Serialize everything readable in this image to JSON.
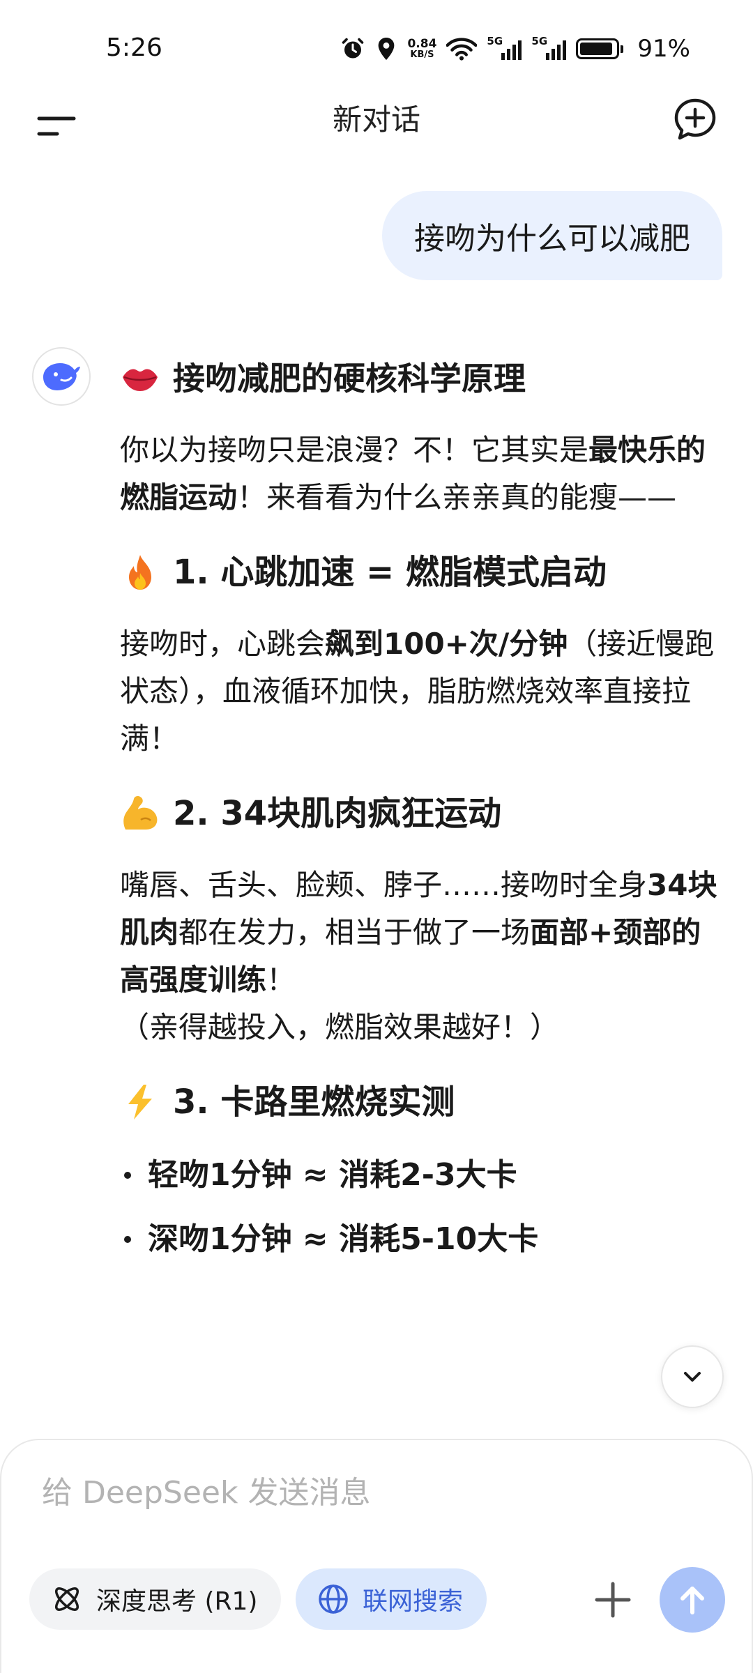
{
  "status_bar": {
    "time": "5:26",
    "net_speed_value": "0.84",
    "net_speed_unit": "KB/S",
    "sim1_label": "5G",
    "sim2_label": "5G",
    "battery_level": 0.91,
    "battery_text": "91%"
  },
  "header": {
    "title": "新对话",
    "menu_icon": "menu-icon",
    "new_chat_icon": "new-chat-icon"
  },
  "user_message": "接吻为什么可以减肥",
  "assistant": {
    "heading": "接吻减肥的硬核科学原理",
    "heading_emoji": "lips",
    "intro_1": "你以为接吻只是浪漫？不！它其实是",
    "intro_bold": "最快乐的燃脂运动",
    "intro_2": "！来看看为什么亲亲真的能瘦——",
    "section1": {
      "emoji": "fire",
      "title": "1. 心跳加速 = 燃脂模式启动",
      "p_1": "接吻时，心跳会",
      "p_bold": "飙到100+次/分钟",
      "p_2": "（接近慢跑状态），血液循环加快，脂肪燃烧效率直接拉满！"
    },
    "section2": {
      "emoji": "flexed-biceps",
      "title": "2. 34块肌肉疯狂运动",
      "p_1": "嘴唇、舌头、脸颊、脖子……接吻时全身",
      "p_bold1": "34块肌肉",
      "p_2": "都在发力，相当于做了一场",
      "p_bold2": "面部+颈部的高强度训练",
      "p_3": "！",
      "note": "（亲得越投入，燃脂效果越好！）"
    },
    "section3": {
      "emoji": "lightning",
      "title": "3. 卡路里燃烧实测",
      "bullets": [
        "轻吻1分钟 ≈ 消耗2-3大卡",
        "深吻1分钟 ≈ 消耗5-10大卡"
      ]
    }
  },
  "composer": {
    "placeholder": "给 DeepSeek 发送消息",
    "deep_think_label": "深度思考 (R1)",
    "web_search_label": "联网搜索"
  },
  "colors": {
    "accent": "#3b62d6",
    "user_bubble": "#eaf1fe",
    "search_chip": "#dbe8fd",
    "send_button": "#a9c2f9"
  }
}
